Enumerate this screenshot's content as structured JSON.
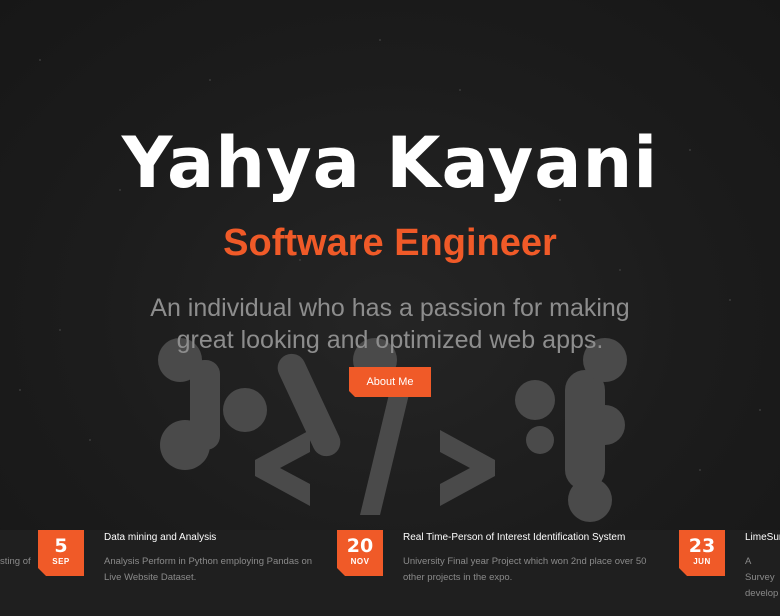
{
  "hero": {
    "name": "Yahya Kayani",
    "role": "Software Engineer",
    "tagline": "An individual who has a passion for making great looking and optimized web apps.",
    "about_button": "About Me"
  },
  "timeline": {
    "partial_left_desc": "sting of",
    "items": [
      {
        "day": "5",
        "month": "SEP",
        "title": "Data mining and Analysis",
        "description": "Analysis Perform in Python employing Pandas on Live Website Dataset."
      },
      {
        "day": "20",
        "month": "NOV",
        "title": "Real Time-Person of Interest Identification System",
        "description": "University Final year Project which won 2nd place over 50 other projects in the expo."
      },
      {
        "day": "23",
        "month": "JUN",
        "title": "LimeSur",
        "description": "A Survey develop"
      }
    ]
  },
  "colors": {
    "accent": "#f05a28",
    "background": "#1b1b1b",
    "muted_text": "#8a8a8a"
  }
}
